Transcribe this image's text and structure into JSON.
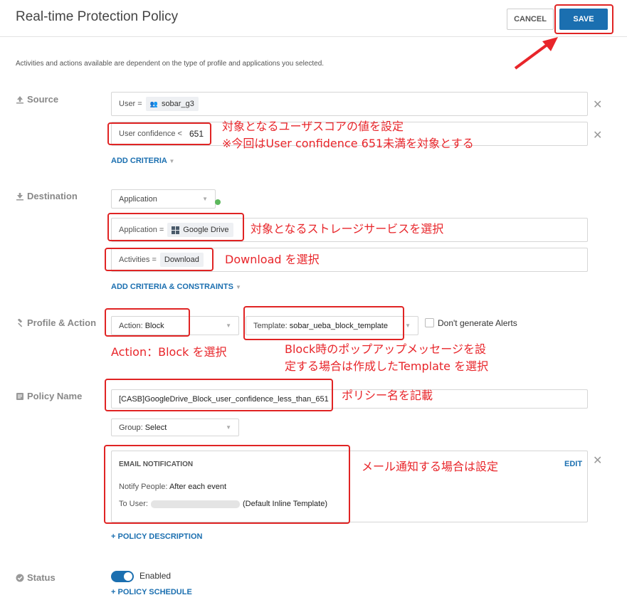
{
  "header": {
    "title": "Real-time Protection Policy",
    "cancel_label": "CANCEL",
    "save_label": "SAVE"
  },
  "info_text": "Activities and actions available are dependent on the type of profile and applications you selected.",
  "source": {
    "label": "Source",
    "user_criteria": {
      "key": "User =",
      "value": "sobar_g3"
    },
    "confidence_criteria": {
      "key": "User confidence <",
      "value": "651"
    },
    "add_criteria": "ADD CRITERIA"
  },
  "destination": {
    "label": "Destination",
    "type_select": "Application",
    "application_criteria": {
      "key": "Application =",
      "value": "Google Drive"
    },
    "activities_criteria": {
      "key": "Activities =",
      "value": "Download"
    },
    "add_criteria": "ADD CRITERIA & CONSTRAINTS"
  },
  "profile_action": {
    "label": "Profile & Action",
    "action": {
      "key": "Action:",
      "value": "Block"
    },
    "template": {
      "key": "Template:",
      "value": "sobar_ueba_block_template"
    },
    "dont_generate_alerts": "Don't generate Alerts"
  },
  "policy_name": {
    "label": "Policy Name",
    "value": "[CASB]GoogleDrive_Block_user_confidence_less_than_651",
    "group": {
      "key": "Group:",
      "value": "Select"
    }
  },
  "email_notification": {
    "title": "EMAIL NOTIFICATION",
    "edit": "EDIT",
    "notify_key": "Notify People:",
    "notify_value": "After each event",
    "to_user_key": "To User:",
    "to_user_suffix": "(Default Inline Template)"
  },
  "policy_description_link": "+ POLICY DESCRIPTION",
  "status": {
    "label": "Status",
    "value": "Enabled",
    "schedule_link": "+ POLICY SCHEDULE"
  },
  "annotations": {
    "confidence_1": "対象となるユーザスコアの値を設定",
    "confidence_2": "※今回はUser confidence 651未満を対象とする",
    "storage": "対象となるストレージサービスを選択",
    "download": "Download を選択",
    "action": "Action：Block を選択",
    "template_1": "Block時のポップアップメッセージを設",
    "template_2": "定する場合は作成したTemplate を選択",
    "policy_name": "ポリシー名を記載",
    "email": "メール通知する場合は設定"
  },
  "colors": {
    "accent": "#1b6fb0",
    "annotation": "#e8252a",
    "toggle_dot": "#5cb85c"
  }
}
